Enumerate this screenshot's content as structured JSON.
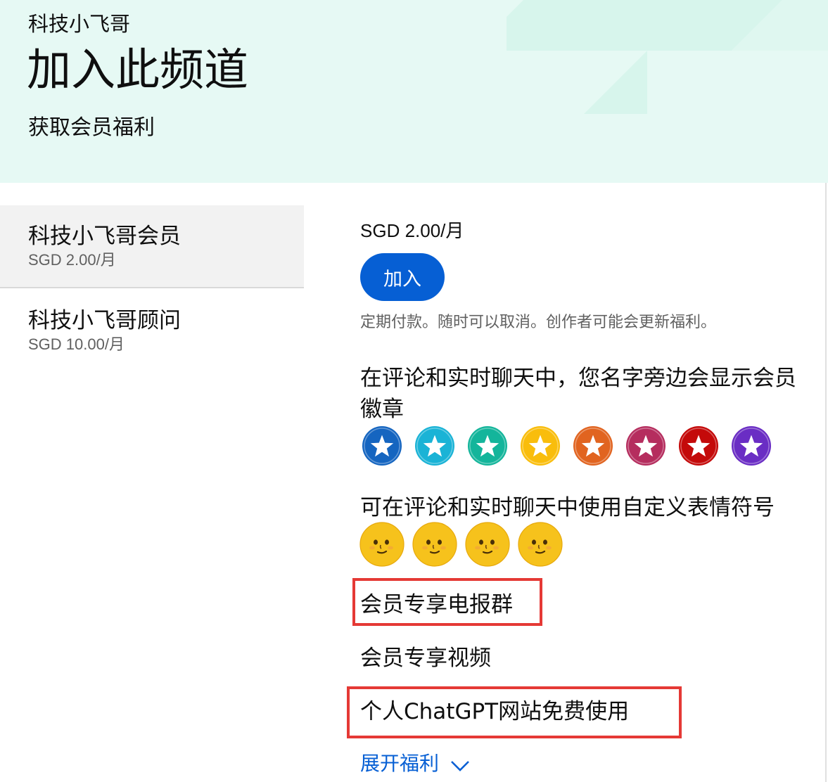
{
  "header": {
    "channel_name": "科技小飞哥",
    "title": "加入此频道",
    "subtitle": "获取会员福利"
  },
  "tiers": [
    {
      "name": "科技小飞哥会员",
      "price": "SGD 2.00/月",
      "selected": true
    },
    {
      "name": "科技小飞哥顾问",
      "price": "SGD 10.00/月",
      "selected": false
    }
  ],
  "detail": {
    "price": "SGD 2.00/月",
    "join_label": "加入",
    "note": "定期付款。随时可以取消。创作者可能会更新福利。",
    "perks": {
      "badges": "在评论和实时聊天中，您名字旁边会显示会员徽章",
      "emoji": "可在评论和实时聊天中使用自定义表情符号",
      "telegram": "会员专享电报群",
      "videos": "会员专享视频",
      "chatgpt": "个人ChatGPT网站免费使用"
    },
    "badge_colors": [
      "#1565c0",
      "#1ab3d6",
      "#14b59b",
      "#f9bd0c",
      "#e16420",
      "#b52d5e",
      "#c40a0a",
      "#6a2dc4"
    ],
    "emoji_count": 4,
    "expand_label": "展开福利"
  },
  "colors": {
    "header_bg": "#e6f9f4",
    "accent": "#065fd4",
    "highlight": "#e53935"
  }
}
